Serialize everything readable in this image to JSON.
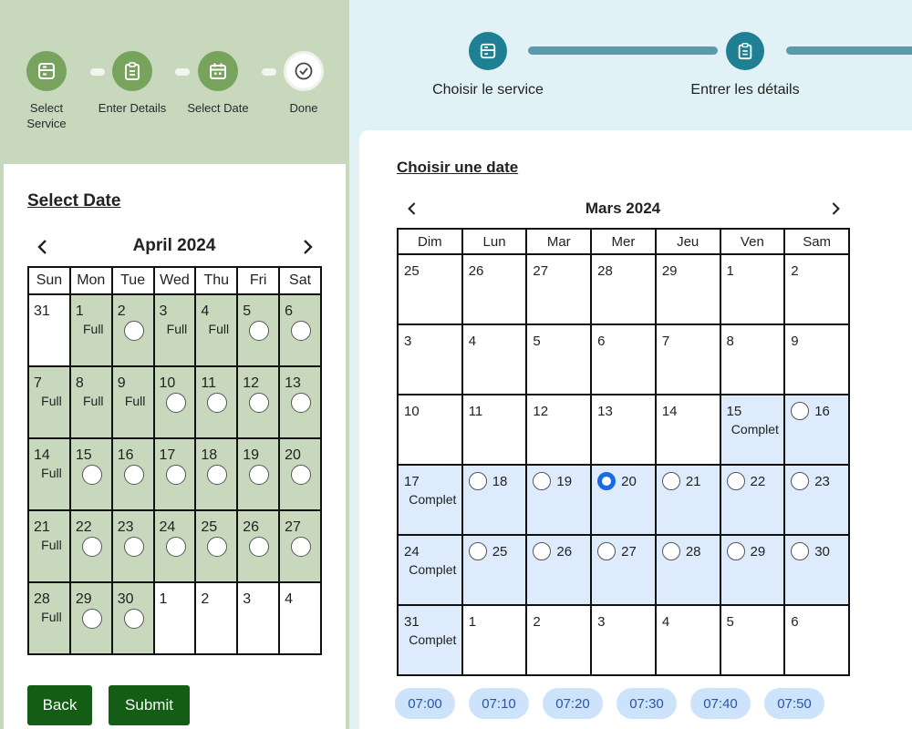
{
  "left_steps": [
    {
      "label": "Select Service",
      "icon": "form-icon"
    },
    {
      "label": "Enter Details",
      "icon": "clipboard-icon"
    },
    {
      "label": "Select Date",
      "icon": "calendar-icon"
    },
    {
      "label": "Done",
      "icon": "check-circle-icon"
    }
  ],
  "left_calendar": {
    "title": "Select Date",
    "month": "April 2024",
    "weekdays": [
      "Sun",
      "Mon",
      "Tue",
      "Wed",
      "Thu",
      "Fri",
      "Sat"
    ],
    "full_label": "Full",
    "weeks": [
      [
        {
          "day": "31",
          "state": "out"
        },
        {
          "day": "1",
          "state": "full"
        },
        {
          "day": "2",
          "state": "open"
        },
        {
          "day": "3",
          "state": "full"
        },
        {
          "day": "4",
          "state": "full"
        },
        {
          "day": "5",
          "state": "open"
        },
        {
          "day": "6",
          "state": "open"
        }
      ],
      [
        {
          "day": "7",
          "state": "full"
        },
        {
          "day": "8",
          "state": "full"
        },
        {
          "day": "9",
          "state": "full"
        },
        {
          "day": "10",
          "state": "open"
        },
        {
          "day": "11",
          "state": "open"
        },
        {
          "day": "12",
          "state": "open"
        },
        {
          "day": "13",
          "state": "open"
        }
      ],
      [
        {
          "day": "14",
          "state": "full"
        },
        {
          "day": "15",
          "state": "open"
        },
        {
          "day": "16",
          "state": "open"
        },
        {
          "day": "17",
          "state": "open"
        },
        {
          "day": "18",
          "state": "open"
        },
        {
          "day": "19",
          "state": "open"
        },
        {
          "day": "20",
          "state": "open"
        }
      ],
      [
        {
          "day": "21",
          "state": "full"
        },
        {
          "day": "22",
          "state": "open"
        },
        {
          "day": "23",
          "state": "open"
        },
        {
          "day": "24",
          "state": "open"
        },
        {
          "day": "25",
          "state": "open"
        },
        {
          "day": "26",
          "state": "open"
        },
        {
          "day": "27",
          "state": "open"
        }
      ],
      [
        {
          "day": "28",
          "state": "full"
        },
        {
          "day": "29",
          "state": "open"
        },
        {
          "day": "30",
          "state": "open"
        },
        {
          "day": "1",
          "state": "out"
        },
        {
          "day": "2",
          "state": "out"
        },
        {
          "day": "3",
          "state": "out"
        },
        {
          "day": "4",
          "state": "out"
        }
      ]
    ]
  },
  "buttons": {
    "back": "Back",
    "submit": "Submit"
  },
  "right_steps": [
    {
      "label": "Choisir le service",
      "icon": "form-icon"
    },
    {
      "label": "Entrer les détails",
      "icon": "clipboard-icon"
    }
  ],
  "right_calendar": {
    "title": "Choisir une date",
    "month": "Mars 2024",
    "weekdays": [
      "Dim",
      "Lun",
      "Mar",
      "Mer",
      "Jeu",
      "Ven",
      "Sam"
    ],
    "full_label": "Complet",
    "weeks": [
      [
        {
          "day": "25",
          "state": "out"
        },
        {
          "day": "26",
          "state": "out"
        },
        {
          "day": "27",
          "state": "out"
        },
        {
          "day": "28",
          "state": "out"
        },
        {
          "day": "29",
          "state": "out"
        },
        {
          "day": "1",
          "state": "out"
        },
        {
          "day": "2",
          "state": "out"
        }
      ],
      [
        {
          "day": "3",
          "state": "out"
        },
        {
          "day": "4",
          "state": "out"
        },
        {
          "day": "5",
          "state": "out"
        },
        {
          "day": "6",
          "state": "out"
        },
        {
          "day": "7",
          "state": "out"
        },
        {
          "day": "8",
          "state": "out"
        },
        {
          "day": "9",
          "state": "out"
        }
      ],
      [
        {
          "day": "10",
          "state": "out"
        },
        {
          "day": "11",
          "state": "out"
        },
        {
          "day": "12",
          "state": "out"
        },
        {
          "day": "13",
          "state": "out"
        },
        {
          "day": "14",
          "state": "out"
        },
        {
          "day": "15",
          "state": "full"
        },
        {
          "day": "16",
          "state": "open"
        }
      ],
      [
        {
          "day": "17",
          "state": "full"
        },
        {
          "day": "18",
          "state": "open"
        },
        {
          "day": "19",
          "state": "open"
        },
        {
          "day": "20",
          "state": "selected"
        },
        {
          "day": "21",
          "state": "open"
        },
        {
          "day": "22",
          "state": "open"
        },
        {
          "day": "23",
          "state": "open"
        }
      ],
      [
        {
          "day": "24",
          "state": "full"
        },
        {
          "day": "25",
          "state": "open"
        },
        {
          "day": "26",
          "state": "open"
        },
        {
          "day": "27",
          "state": "open"
        },
        {
          "day": "28",
          "state": "open"
        },
        {
          "day": "29",
          "state": "open"
        },
        {
          "day": "30",
          "state": "open"
        }
      ],
      [
        {
          "day": "31",
          "state": "full"
        },
        {
          "day": "1",
          "state": "out"
        },
        {
          "day": "2",
          "state": "out"
        },
        {
          "day": "3",
          "state": "out"
        },
        {
          "day": "4",
          "state": "out"
        },
        {
          "day": "5",
          "state": "out"
        },
        {
          "day": "6",
          "state": "out"
        }
      ]
    ]
  },
  "time_slots": [
    "07:00",
    "07:10",
    "07:20",
    "07:30",
    "07:40",
    "07:50"
  ],
  "colors": {
    "left_panel_bg": "#c8d8bd",
    "left_step_active": "#78a35d",
    "button_green": "#135e14",
    "right_panel_bg": "#e0f2f6",
    "right_step_teal": "#1f7f93",
    "available_blue": "#ddebfd",
    "selected_radio": "#1a6ae3",
    "time_pill": "#cde2fb"
  }
}
